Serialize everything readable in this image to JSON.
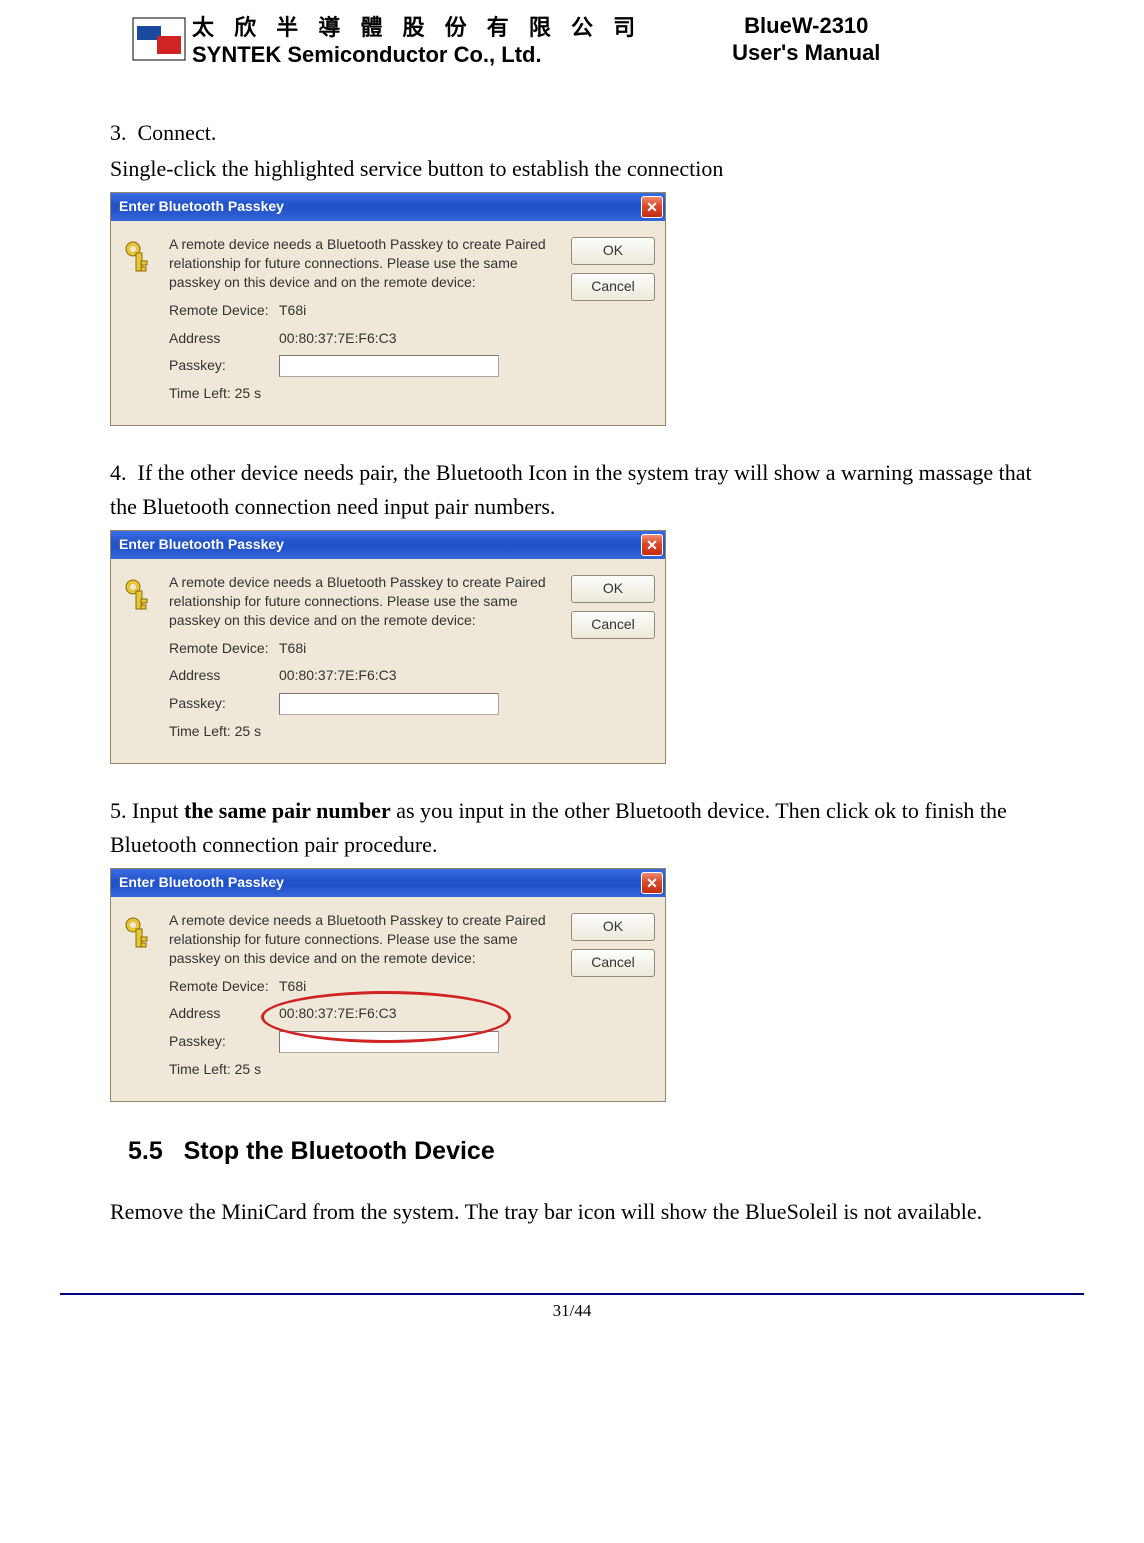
{
  "header": {
    "company_cn": "太 欣 半 導 體 股 份 有 限 公 司",
    "company_en": "SYNTEK Semiconductor Co., Ltd.",
    "product_line1": "BlueW-2310",
    "product_line2": "User's Manual"
  },
  "steps": {
    "s3_num": "3.",
    "s3_title": "Connect.",
    "s3_body": "Single-click the highlighted service button to establish the connection",
    "s4_num": "4.",
    "s4_body": "If the other device needs pair, the Bluetooth Icon in the system tray will show a warning massage that the Bluetooth connection need input pair numbers.",
    "s5_num": "5.",
    "s5_pre": " Input ",
    "s5_bold": "the same pair number",
    "s5_post": " as you input in the other Bluetooth device. Then click ok to finish the Bluetooth connection pair procedure."
  },
  "dialog": {
    "title": "Enter Bluetooth Passkey",
    "close_glyph": "✕",
    "message": "A remote device needs a Bluetooth Passkey to create Paired relationship for future connections. Please use the same passkey on this device and on the remote device:",
    "remote_label": "Remote Device:",
    "remote_value": "T68i",
    "address_label": "Address",
    "address_value": "00:80:37:7E:F6:C3",
    "passkey_label": "Passkey:",
    "passkey_value": "",
    "time_label": "Time Left: 25 s",
    "ok": "OK",
    "cancel": "Cancel"
  },
  "section": {
    "num": "5.5",
    "title": "Stop the Bluetooth Device",
    "body": "Remove the MiniCard from the system. The tray bar icon will show the BlueSoleil is not available."
  },
  "footer": {
    "page": "31/44"
  }
}
